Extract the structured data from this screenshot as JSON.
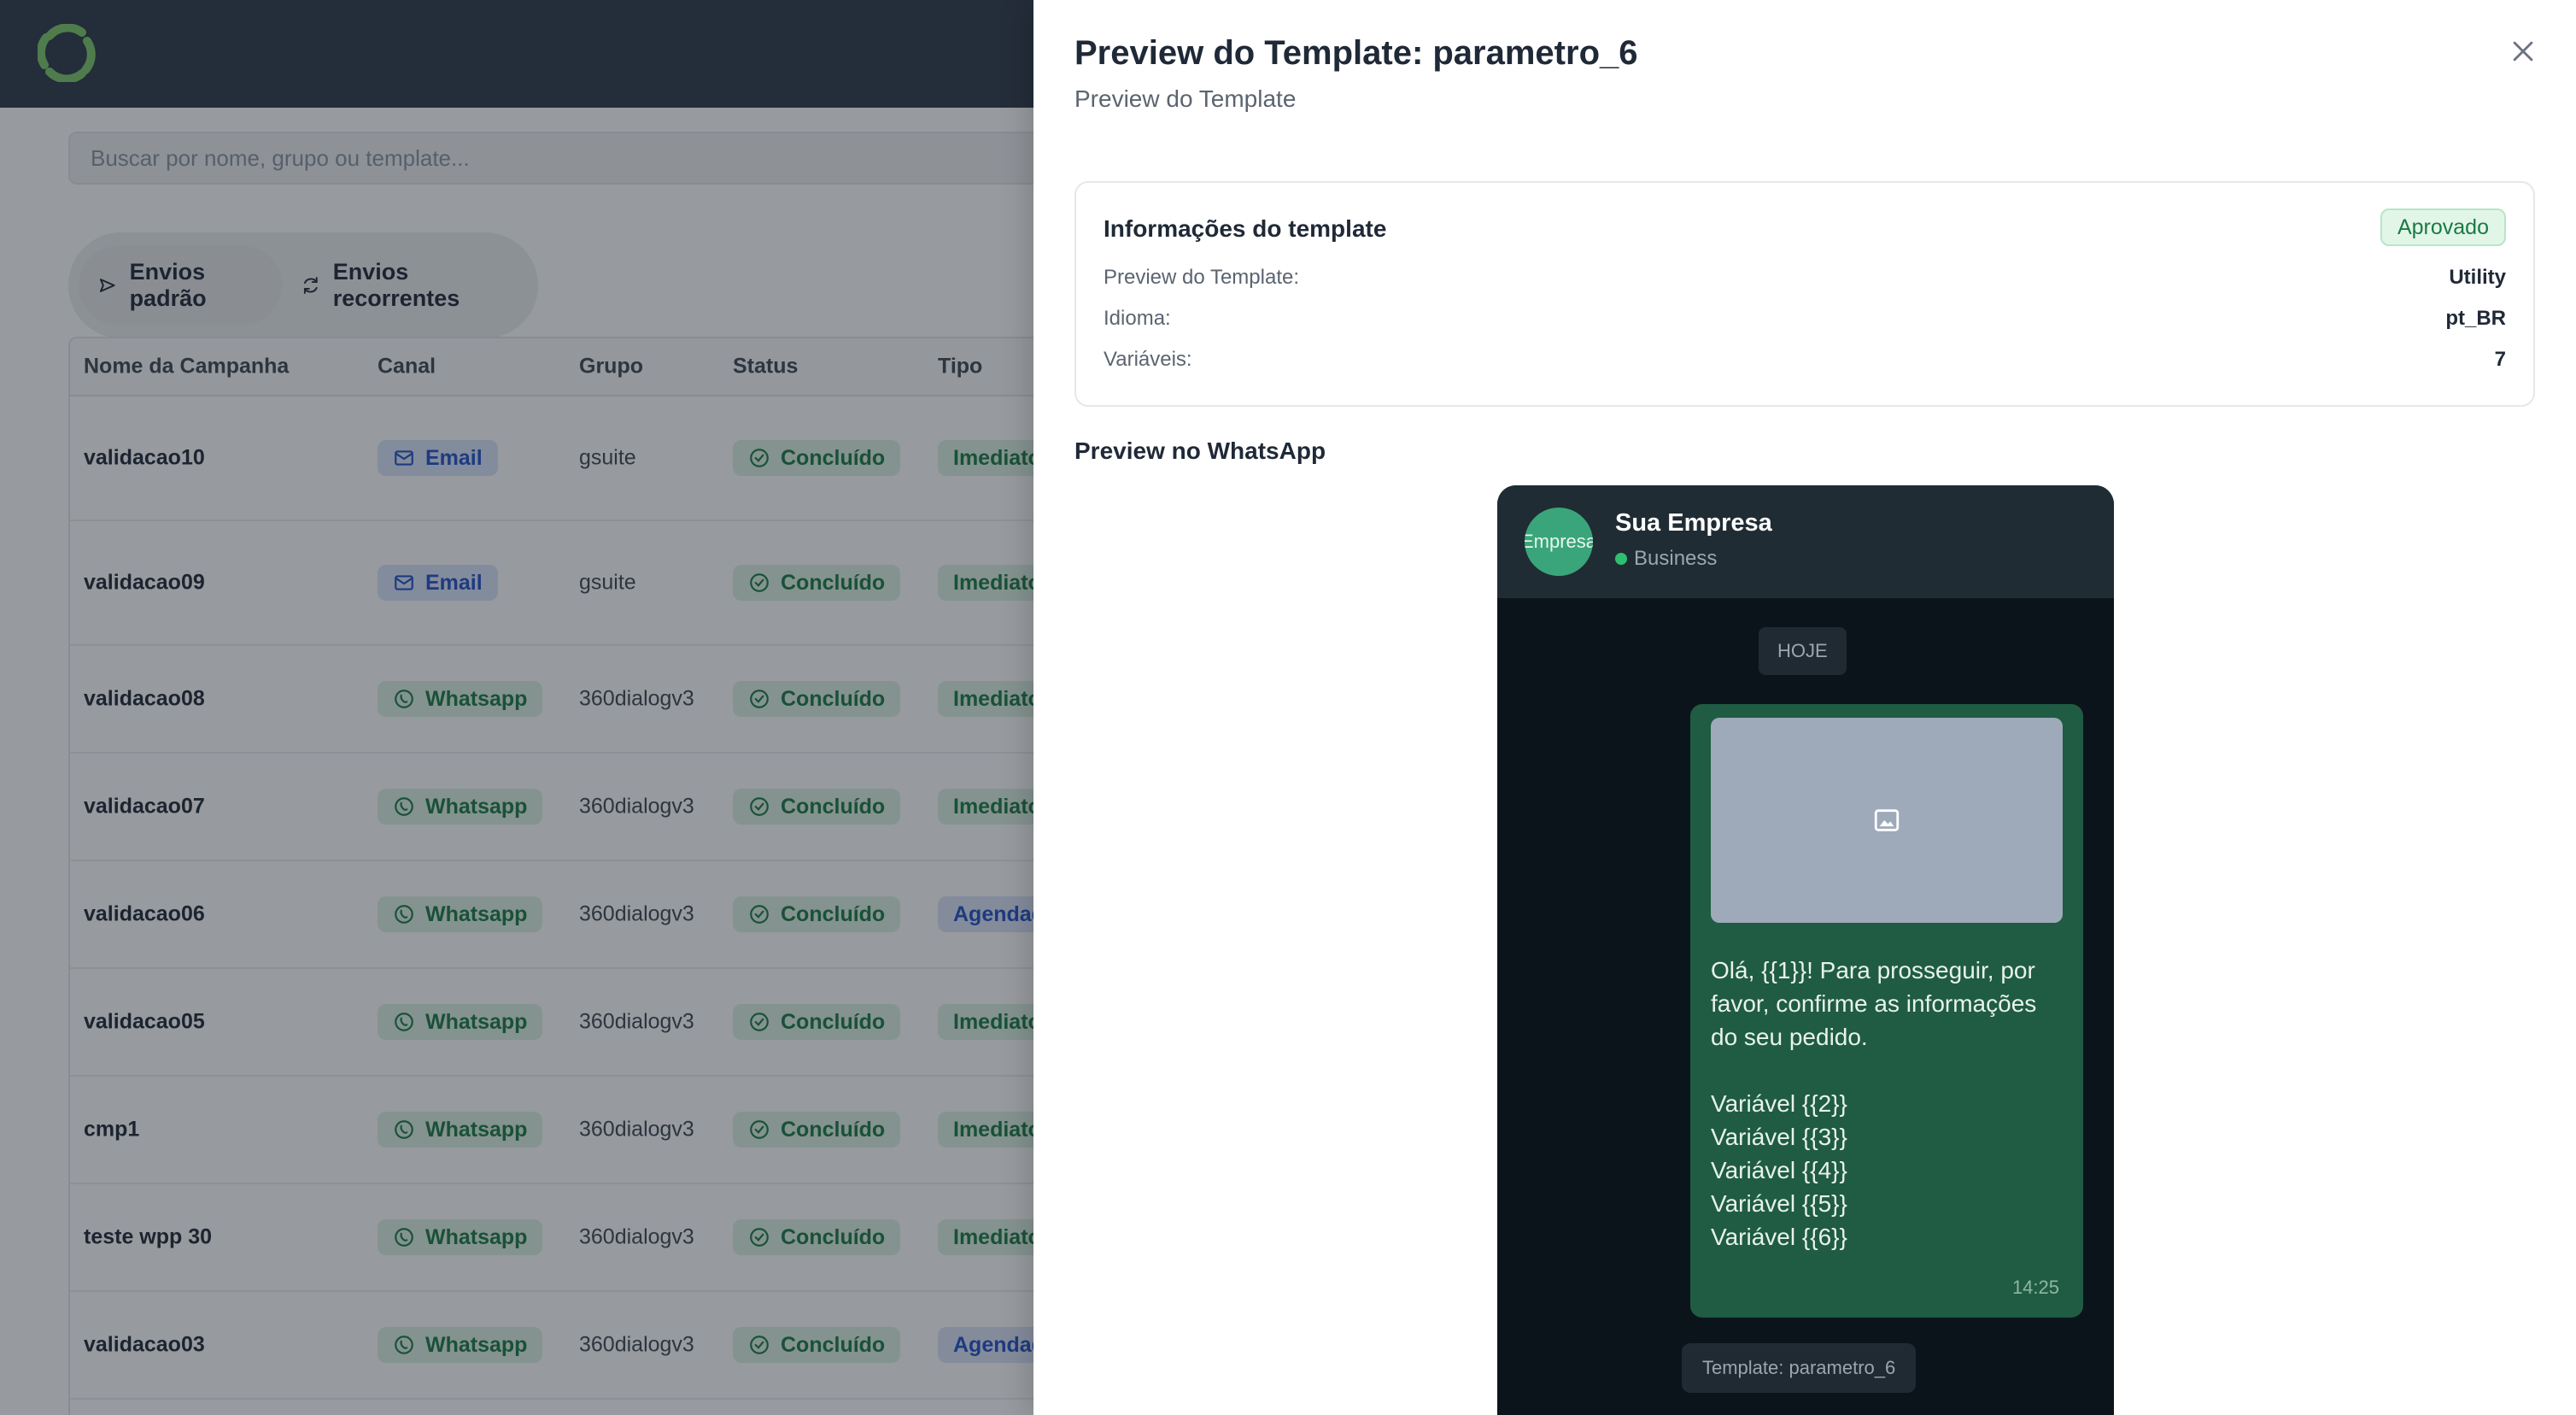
{
  "app": {
    "search_placeholder": "Buscar por nome, grupo ou template...",
    "tabs": [
      {
        "label": "Envios padrão",
        "icon": "send-icon",
        "active": true
      },
      {
        "label": "Envios recorrentes",
        "icon": "refresh-icon",
        "active": false
      }
    ],
    "table": {
      "headers": [
        "Nome da Campanha",
        "Canal",
        "Grupo",
        "Status",
        "Tipo"
      ],
      "rows": [
        {
          "name": "validacao10",
          "channel": "Email",
          "group": "gsuite",
          "status": "Concluído",
          "type": "Imediato"
        },
        {
          "name": "validacao09",
          "channel": "Email",
          "group": "gsuite",
          "status": "Concluído",
          "type": "Imediato"
        },
        {
          "name": "validacao08",
          "channel": "Whatsapp",
          "group": "360dialogv3",
          "status": "Concluído",
          "type": "Imediato"
        },
        {
          "name": "validacao07",
          "channel": "Whatsapp",
          "group": "360dialogv3",
          "status": "Concluído",
          "type": "Imediato"
        },
        {
          "name": "validacao06",
          "channel": "Whatsapp",
          "group": "360dialogv3",
          "status": "Concluído",
          "type": "Agendado"
        },
        {
          "name": "validacao05",
          "channel": "Whatsapp",
          "group": "360dialogv3",
          "status": "Concluído",
          "type": "Imediato"
        },
        {
          "name": "cmp1",
          "channel": "Whatsapp",
          "group": "360dialogv3",
          "status": "Concluído",
          "type": "Imediato"
        },
        {
          "name": "teste wpp 30",
          "channel": "Whatsapp",
          "group": "360dialogv3",
          "status": "Concluído",
          "type": "Imediato"
        },
        {
          "name": "validacao03",
          "channel": "Whatsapp",
          "group": "360dialogv3",
          "status": "Concluído",
          "type": "Agendado"
        }
      ]
    }
  },
  "panel": {
    "title": "Preview do Template: parametro_6",
    "subtitle": "Preview do Template",
    "info": {
      "title": "Informações do template",
      "badge": "Aprovado",
      "rows": [
        {
          "label": "Preview do Template:",
          "value": "Utility"
        },
        {
          "label": "Idioma:",
          "value": "pt_BR"
        },
        {
          "label": "Variáveis:",
          "value": "7"
        }
      ]
    },
    "whatsapp_label": "Preview no WhatsApp",
    "phone": {
      "avatar_text": "Empresa",
      "business_name": "Sua Empresa",
      "business_status": "Business",
      "day_label": "HOJE",
      "message": "Olá, {{1}}! Para prosseguir, por favor, confirme as informações do seu pedido.\n\nVariável {{2}}\nVariável {{3}}\nVariável {{4}}\nVariável {{5}}\nVariável {{6}}",
      "time": "14:25",
      "template_tag": "Template: parametro_6"
    }
  },
  "colors": {
    "topbar": "#2f3949",
    "logo_green": "#7cc96a",
    "whatsapp_bubble": "#1f5c43",
    "success_text": "#1a7a45",
    "info_text": "#2452c8"
  }
}
